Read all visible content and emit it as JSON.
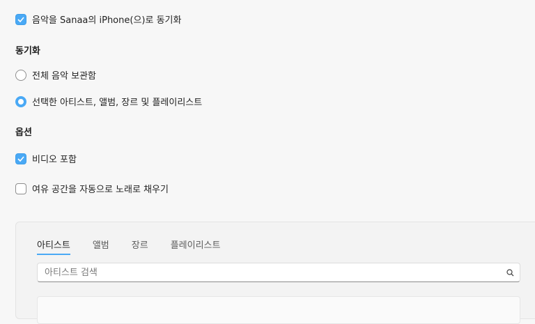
{
  "sync_music": {
    "label": "음악을 Sanaa의 iPhone(으)로 동기화",
    "checked": true
  },
  "sync_section": {
    "heading": "동기화",
    "options": [
      {
        "label": "전체 음악 보관함",
        "selected": false
      },
      {
        "label": "선택한 아티스트, 앨범, 장르 및 플레이리스트",
        "selected": true
      }
    ]
  },
  "options_section": {
    "heading": "옵션",
    "include_videos": {
      "label": "비디오 포함",
      "checked": true
    },
    "autofill": {
      "label": "여유 공간을 자동으로 노래로 채우기",
      "checked": false
    }
  },
  "panel": {
    "tabs": [
      {
        "label": "아티스트",
        "active": true
      },
      {
        "label": "앨범",
        "active": false
      },
      {
        "label": "장르",
        "active": false
      },
      {
        "label": "플레이리스트",
        "active": false
      }
    ],
    "search": {
      "placeholder": "아티스트 검색",
      "value": ""
    }
  },
  "colors": {
    "accent": "#4aa9f5",
    "background": "#f7f7f7"
  }
}
